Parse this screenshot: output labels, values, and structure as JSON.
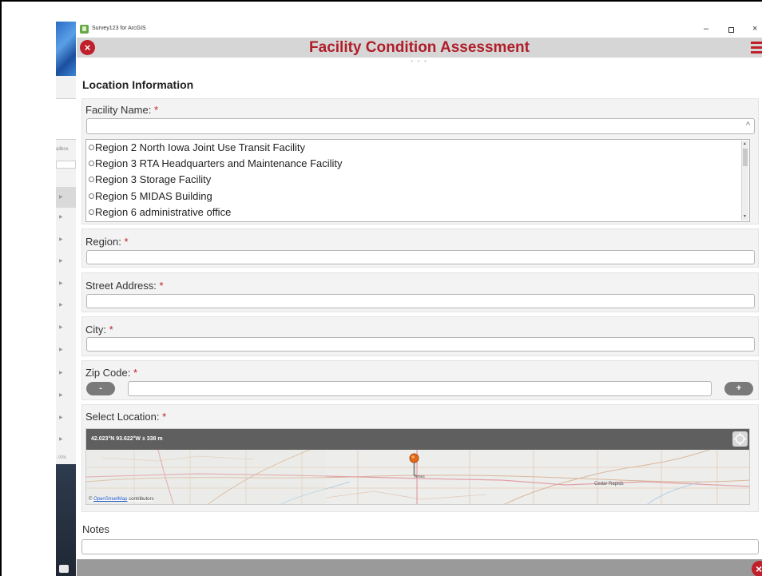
{
  "app": {
    "window_title": "Survey123 for ArcGIS",
    "controls": {
      "minimize": "–",
      "maximize": "▫",
      "close": "×"
    }
  },
  "header": {
    "title": "Facility Condition Assessment",
    "close_icon": "×",
    "menu_icon": "hamburger-icon",
    "brand_color": "#b01e2a",
    "page_dots": "• • •"
  },
  "section": {
    "title": "Location Information"
  },
  "background_app": {
    "mailbox_label": "ailbox",
    "zoom_text": "- 90%"
  },
  "questions": {
    "facility_name": {
      "label": "Facility Name:",
      "required": "*",
      "value": "",
      "dropdown_icon": "^",
      "options": [
        "Region 2 North Iowa Joint Use Transit Facility",
        "Region 3 RTA Headquarters and Maintenance Facility",
        "Region 3 Storage Facility",
        "Region 5 MIDAS Building",
        "Region 6 administrative office"
      ]
    },
    "region": {
      "label": "Region:",
      "required": "*",
      "value": ""
    },
    "street_address": {
      "label": "Street Address:",
      "required": "*",
      "value": ""
    },
    "city": {
      "label": "City:",
      "required": "*",
      "value": ""
    },
    "zip_code": {
      "label": "Zip Code:",
      "required": "*",
      "value": "",
      "minus_label": "-",
      "plus_label": "+"
    },
    "select_location": {
      "label": "Select Location:",
      "required": "*",
      "coordinates": "42.023°N 93.622°W ± 338 m",
      "attribution_prefix": "© ",
      "attribution_link": "OpenStreetMap",
      "attribution_suffix": " contributors",
      "map_labels": {
        "pin_city": "Ames",
        "east_city": "Cedar Rapids"
      }
    },
    "notes": {
      "label": "Notes",
      "value": ""
    }
  },
  "footer": {
    "close_icon": "×"
  }
}
